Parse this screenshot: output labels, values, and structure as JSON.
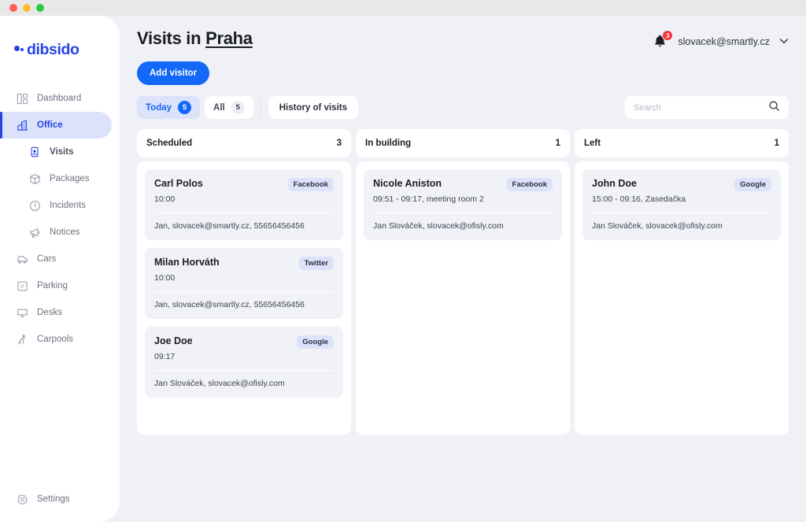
{
  "window": {
    "traffic_lights": [
      "close",
      "minimize",
      "maximize"
    ]
  },
  "sidebar": {
    "logo_text": "dibsido",
    "items": [
      {
        "label": "Dashboard",
        "icon": "dashboard-icon",
        "active": false,
        "sub": false
      },
      {
        "label": "Office",
        "icon": "office-building-icon",
        "active": true,
        "sub": false
      },
      {
        "label": "Visits",
        "icon": "visits-badge-icon",
        "active": false,
        "sub": true
      },
      {
        "label": "Packages",
        "icon": "package-box-icon",
        "active": false,
        "sub": true
      },
      {
        "label": "Incidents",
        "icon": "alert-circle-icon",
        "active": false,
        "sub": true
      },
      {
        "label": "Notices",
        "icon": "megaphone-icon",
        "active": false,
        "sub": true
      },
      {
        "label": "Cars",
        "icon": "car-icon",
        "active": false,
        "sub": false
      },
      {
        "label": "Parking",
        "icon": "parking-p-icon",
        "active": false,
        "sub": false
      },
      {
        "label": "Desks",
        "icon": "desk-monitor-icon",
        "active": false,
        "sub": false
      },
      {
        "label": "Carpools",
        "icon": "carpool-icon",
        "active": false,
        "sub": false
      }
    ],
    "settings": {
      "label": "Settings",
      "icon": "gear-icon"
    }
  },
  "header": {
    "title_prefix": "Visits in ",
    "title_location": "Praha",
    "notifications_count": "3",
    "account_email": "slovacek@smartly.cz",
    "caret_icon": "chevron-down-icon",
    "bell_icon": "bell-icon"
  },
  "toolbar": {
    "add_visitor_label": "Add visitor",
    "tabs": [
      {
        "label": "Today",
        "count": "5",
        "active": true
      },
      {
        "label": "All",
        "count": "5",
        "active": false
      }
    ],
    "history_label": "History of visits",
    "search_placeholder": "Search",
    "search_value": "",
    "search_icon": "search-icon"
  },
  "board": {
    "columns": [
      {
        "title": "Scheduled",
        "count": "3",
        "cards": [
          {
            "name": "Carl Polos",
            "badge": "Facebook",
            "time": "10:00",
            "host": "Jan, slovacek@smartly.cz, 55656456456"
          },
          {
            "name": "Milan Horváth",
            "badge": "Twitter",
            "time": "10:00",
            "host": "Jan, slovacek@smartly.cz, 55656456456"
          },
          {
            "name": "Joe Doe",
            "badge": "Google",
            "time": "09:17",
            "host": "Jan Slováček, slovacek@ofisly.com"
          }
        ]
      },
      {
        "title": "In building",
        "count": "1",
        "cards": [
          {
            "name": "Nicole Aniston",
            "badge": "Facebook",
            "time": "09:51 - 09:17, meeting room 2",
            "host": "Jan Slováček, slovacek@ofisly.com"
          }
        ]
      },
      {
        "title": "Left",
        "count": "1",
        "cards": [
          {
            "name": "John Doe",
            "badge": "Google",
            "time": "15:00 - 09:16, Zasedačka",
            "host": "Jan Slováček, slovacek@ofisly.com"
          }
        ]
      }
    ]
  },
  "colors": {
    "brand_blue": "#2543e6",
    "accent_blue": "#1368f7",
    "badge_lavender": "#dde2fb",
    "app_background": "#f0f1f7",
    "notification_red": "#f8333c"
  }
}
